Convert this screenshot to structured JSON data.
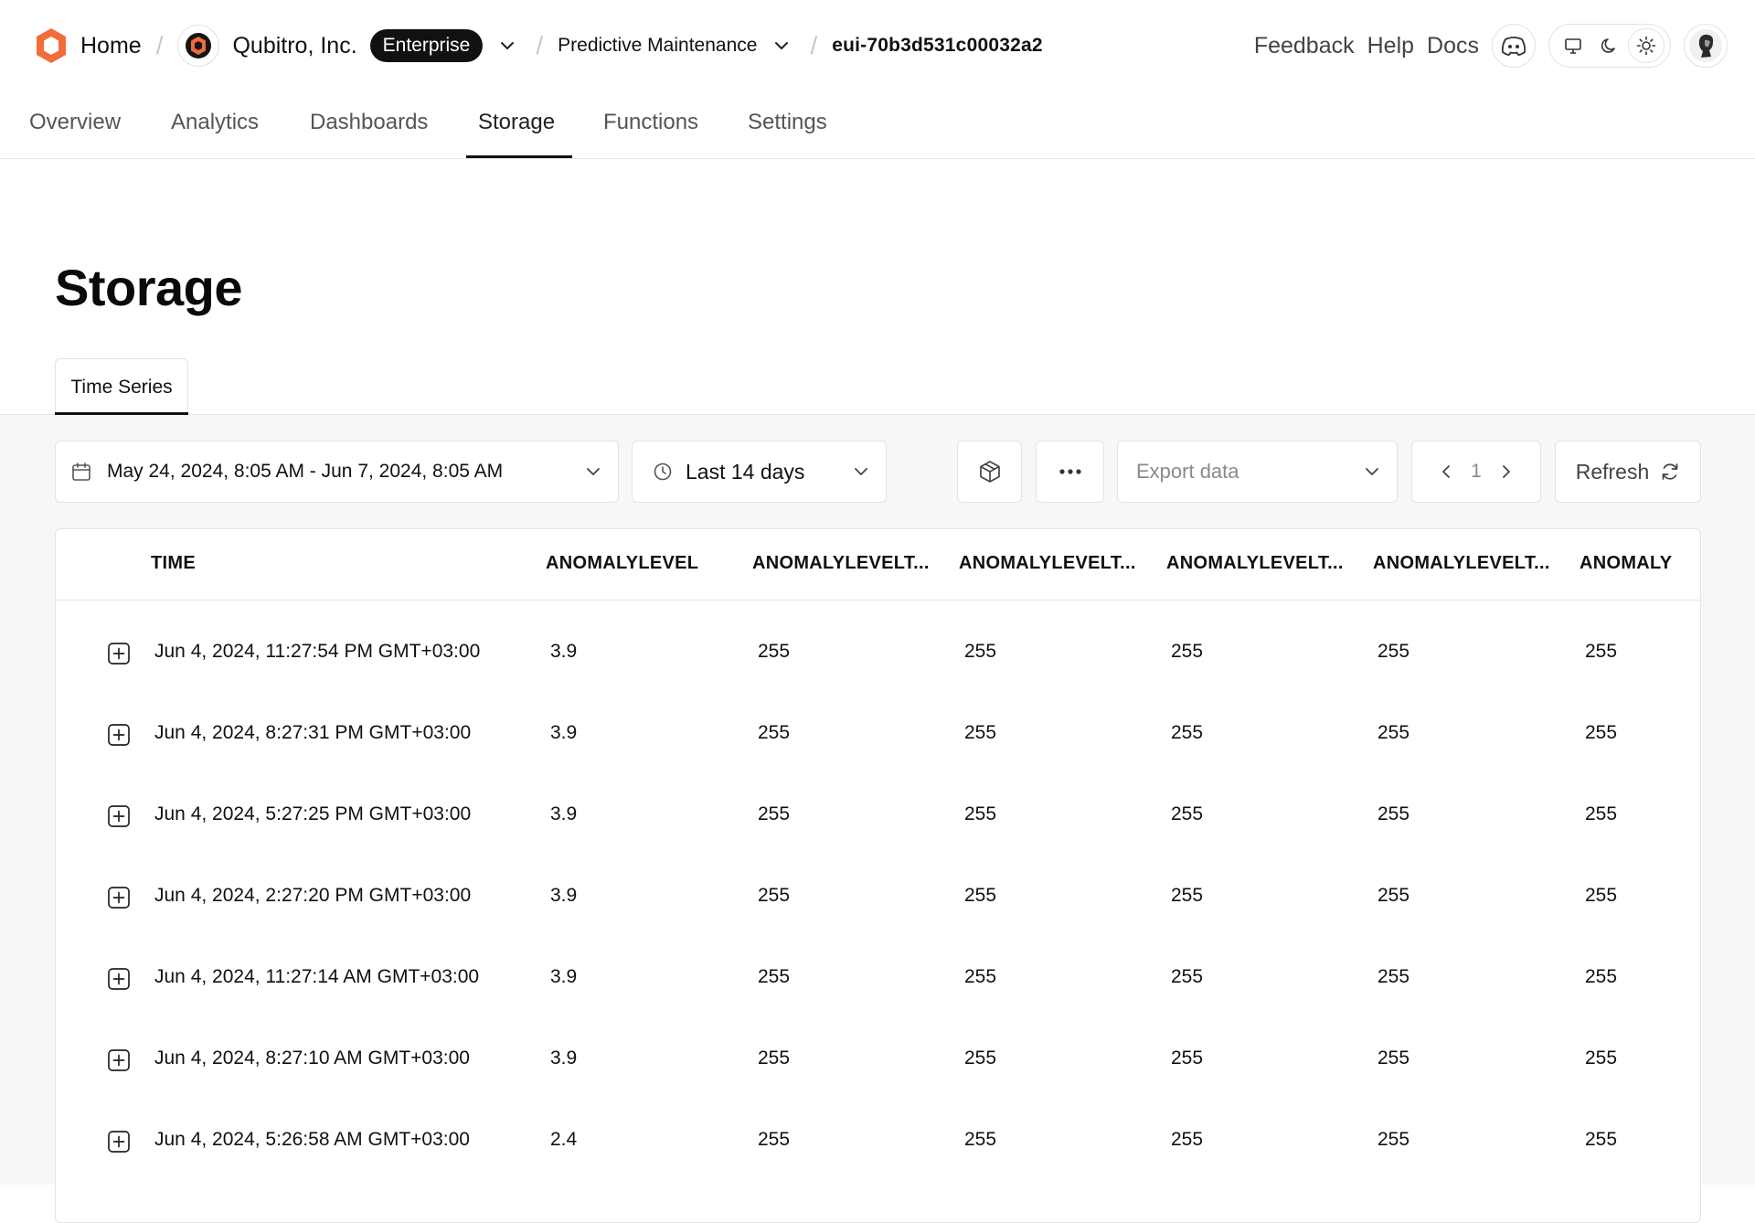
{
  "breadcrumb": {
    "home": "Home",
    "org": "Qubitro, Inc.",
    "plan_badge": "Enterprise",
    "project": "Predictive Maintenance",
    "device": "eui-70b3d531c00032a2"
  },
  "top_links": {
    "feedback": "Feedback",
    "help": "Help",
    "docs": "Docs"
  },
  "nav": {
    "tabs": [
      {
        "label": "Overview"
      },
      {
        "label": "Analytics"
      },
      {
        "label": "Dashboards"
      },
      {
        "label": "Storage"
      },
      {
        "label": "Functions"
      },
      {
        "label": "Settings"
      }
    ],
    "active": "Storage"
  },
  "page": {
    "title": "Storage",
    "subtab": "Time Series"
  },
  "toolbar": {
    "date_range": "May 24, 2024, 8:05 AM - Jun 7, 2024, 8:05 AM",
    "preset": "Last 14 days",
    "export_placeholder": "Export data",
    "page_number": "1",
    "refresh_label": "Refresh"
  },
  "colors": {
    "brand_orange": "#f26b3a",
    "accent_dark": "#111111"
  },
  "table": {
    "columns": [
      "TIME",
      "ANOMALYLEVEL",
      "ANOMALYLEVELT...",
      "ANOMALYLEVELT...",
      "ANOMALYLEVELT...",
      "ANOMALYLEVELT...",
      "ANOMALY"
    ],
    "rows": [
      {
        "time": "Jun 4, 2024, 11:27:54 PM GMT+03:00",
        "c1": "3.9",
        "c2": "255",
        "c3": "255",
        "c4": "255",
        "c5": "255",
        "c6": "255"
      },
      {
        "time": "Jun 4, 2024, 8:27:31 PM GMT+03:00",
        "c1": "3.9",
        "c2": "255",
        "c3": "255",
        "c4": "255",
        "c5": "255",
        "c6": "255"
      },
      {
        "time": "Jun 4, 2024, 5:27:25 PM GMT+03:00",
        "c1": "3.9",
        "c2": "255",
        "c3": "255",
        "c4": "255",
        "c5": "255",
        "c6": "255"
      },
      {
        "time": "Jun 4, 2024, 2:27:20 PM GMT+03:00",
        "c1": "3.9",
        "c2": "255",
        "c3": "255",
        "c4": "255",
        "c5": "255",
        "c6": "255"
      },
      {
        "time": "Jun 4, 2024, 11:27:14 AM GMT+03:00",
        "c1": "3.9",
        "c2": "255",
        "c3": "255",
        "c4": "255",
        "c5": "255",
        "c6": "255"
      },
      {
        "time": "Jun 4, 2024, 8:27:10 AM GMT+03:00",
        "c1": "3.9",
        "c2": "255",
        "c3": "255",
        "c4": "255",
        "c5": "255",
        "c6": "255"
      },
      {
        "time": "Jun 4, 2024, 5:26:58 AM GMT+03:00",
        "c1": "2.4",
        "c2": "255",
        "c3": "255",
        "c4": "255",
        "c5": "255",
        "c6": "255"
      }
    ]
  }
}
